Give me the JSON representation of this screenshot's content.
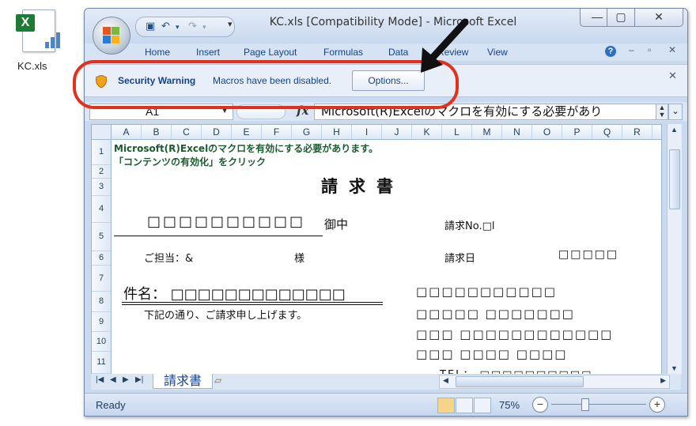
{
  "desktop": {
    "file_label": "KC.xls"
  },
  "window": {
    "title": "KC.xls  [Compatibility Mode] - Microsoft Excel",
    "ribbon_tabs": [
      "Home",
      "Insert",
      "Page Layout",
      "Formulas",
      "Data",
      "Review",
      "View"
    ]
  },
  "security_bar": {
    "title": "Security Warning",
    "message": "Macros have been disabled.",
    "button": "Options..."
  },
  "formula_bar": {
    "name_box": "A1",
    "fx": "fx",
    "formula": "Microsoft(R)Excelのマクロを有効にする必要があり"
  },
  "columns": [
    "A",
    "B",
    "C",
    "D",
    "E",
    "F",
    "G",
    "H",
    "I",
    "J",
    "K",
    "L",
    "M",
    "N",
    "O",
    "P",
    "Q",
    "R"
  ],
  "rows": [
    "1",
    "2",
    "3",
    "4",
    "5",
    "6",
    "7",
    "8",
    "9",
    "10",
    "11"
  ],
  "sheet": {
    "note_line1": "Microsoft(R)Excelのマクロを有効にする必要があります。",
    "note_line2": "「コンテンツの有効化」をクリック",
    "doc_title": "請求書",
    "addressee": "□□□□□□□□□□",
    "honorific": "御中",
    "invoice_no": "請求No.□l",
    "contact": "ご担当：&",
    "sama": "様",
    "invoice_date_label": "請求日",
    "invoice_date_value": "□□□□□",
    "subject": "件名： □□□□□□□□□□□□□",
    "intro": "下記の通り、ご請求申し上げます。",
    "info_lines": [
      "□□□□□□□□□□□",
      "□□□□□ □□□□□□□",
      "□□□ □□□□□□□□□□□□",
      "□□□  □□□□ □□□□",
      "TEL： □□□□□□□□□□"
    ]
  },
  "sheet_tab": "請求書",
  "status": {
    "ready": "Ready",
    "zoom": "75%"
  }
}
